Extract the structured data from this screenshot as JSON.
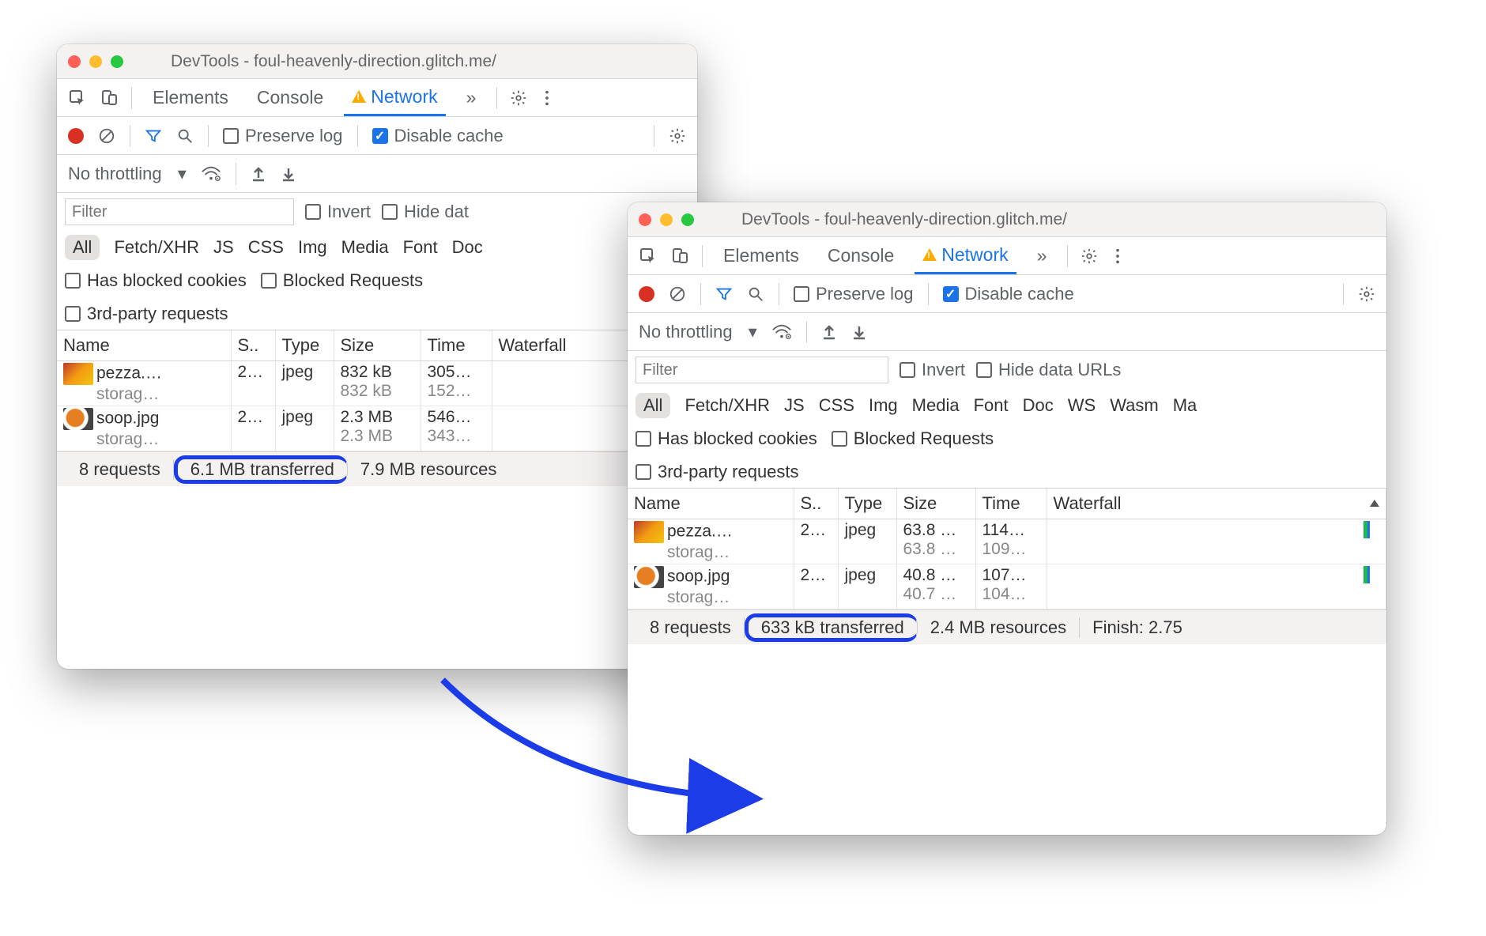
{
  "window_title": "DevTools - foul-heavenly-direction.glitch.me/",
  "tabs": {
    "elements": "Elements",
    "console": "Console",
    "network": "Network",
    "more": "»"
  },
  "toolbar": {
    "preserve": "Preserve log",
    "disable_cache": "Disable cache"
  },
  "throttle_label": "No throttling",
  "filter": {
    "placeholder": "Filter",
    "invert": "Invert",
    "hide_trunc": "Hide dat",
    "hide_full": "Hide data URLs"
  },
  "types": [
    "All",
    "Fetch/XHR",
    "JS",
    "CSS",
    "Img",
    "Media",
    "Font",
    "Doc",
    "WS",
    "Wasm",
    "Ma"
  ],
  "checks": {
    "blocked_cookies": "Has blocked cookies",
    "blocked_req": "Blocked Requests",
    "third_party": "3rd-party requests"
  },
  "headers": {
    "name": "Name",
    "status": "S..",
    "type": "Type",
    "size": "Size",
    "time": "Time",
    "waterfall": "Waterfall"
  },
  "w1": {
    "rows": [
      {
        "name": "pezza.…",
        "domain": "storag…",
        "status": "2…",
        "type": "jpeg",
        "size1": "832 kB",
        "size2": "832 kB",
        "time1": "305…",
        "time2": "152…"
      },
      {
        "name": "soop.jpg",
        "domain": "storag…",
        "status": "2…",
        "type": "jpeg",
        "size1": "2.3 MB",
        "size2": "2.3 MB",
        "time1": "546…",
        "time2": "343…"
      }
    ],
    "status": {
      "requests": "8 requests",
      "transferred": "6.1 MB transferred",
      "resources": "7.9 MB resources"
    }
  },
  "w2": {
    "rows": [
      {
        "name": "pezza.…",
        "domain": "storag…",
        "status": "2…",
        "type": "jpeg",
        "size1": "63.8 …",
        "size2": "63.8 …",
        "time1": "114…",
        "time2": "109…"
      },
      {
        "name": "soop.jpg",
        "domain": "storag…",
        "status": "2…",
        "type": "jpeg",
        "size1": "40.8 …",
        "size2": "40.7 …",
        "time1": "107…",
        "time2": "104…"
      }
    ],
    "status": {
      "requests": "8 requests",
      "transferred": "633 kB transferred",
      "resources": "2.4 MB resources",
      "finish": "Finish: 2.75"
    }
  }
}
